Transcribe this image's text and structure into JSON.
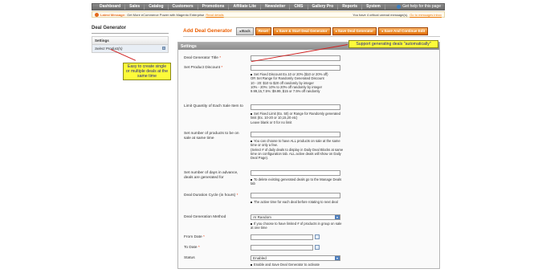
{
  "topnav": {
    "items": [
      "Dashboard",
      "Sales",
      "Catalog",
      "Customers",
      "Promotions",
      "Affiliate Lite",
      "Newsletter",
      "CMS",
      "Gallery Pro",
      "Reports",
      "System"
    ],
    "help": "Get help for this page"
  },
  "message": {
    "title": "Latest Message:",
    "text": "Get More eCommerce Power with Magento Enterprise",
    "link": "Read details",
    "right_text": "You have 4 critical unread message(s).",
    "right_link": "Go to messages inbox"
  },
  "sidebar": {
    "title": "Deal Generator",
    "section": "Settings",
    "item": "Select Product(s)"
  },
  "callouts": {
    "left": "Easy to create single or multiple deals at the same time",
    "right": "Support generating deals \"automatically\""
  },
  "header": {
    "title": "Add Deal Generator",
    "buttons": {
      "back": "Back",
      "reset": "Reset",
      "save_start": "Save & Start Deal Generator",
      "save": "Save Deal Generator",
      "save_continue": "Save And Continue Edit"
    }
  },
  "form": {
    "panel_title": "Settings",
    "fields": {
      "title": {
        "label": "Deal Generator Title",
        "value": ""
      },
      "discount": {
        "label": "Set Product Discount",
        "value": "",
        "note": [
          "Set Fixed Discount Ex.10 or 20% ($10 or 20% off)",
          "OR Set Range for Randomly Generated Discount",
          "10 - 20: $10 to $20 off randomly by integer",
          "10% - 20%: 10% to 20% off randomly by integer",
          "9.99,15,7.5%: $9.99, $15 or 7.5% off randomly"
        ]
      },
      "limit": {
        "label": "Limit Quantity of Each Sale Item to",
        "value": "",
        "note": [
          "Set Fixed Limit (Ex. 50) or Range for Randomly generated limit (Ex. 10-20 or 10,15,20 etc)",
          "Leave blank or 0 for no limit"
        ]
      },
      "products_count": {
        "label": "Set number of products to be on sale at same time",
        "value": "",
        "note": [
          "You can choose to have ALL products on sale at the same time or only a few.",
          "(Select # of daily deals to display in Daily Deal Blocks at same time on configuration tab. ALL active deals will show on Daily Deal Page)."
        ]
      },
      "days_advance": {
        "label": "Set number of days in advance, deals are generated for",
        "value": "",
        "note": [
          "To delete existing generated deals go to the Manage Deals tab"
        ]
      },
      "duration": {
        "label": "Deal Duration Cycle (in hours)",
        "value": "",
        "note": [
          "The active time for each deal before rotating to next deal"
        ]
      },
      "method": {
        "label": "Deal Generation Method",
        "value": "At Random",
        "note": [
          "If you choose to have limited # of products in group on sale at one time"
        ]
      },
      "from_date": {
        "label": "From Date",
        "value": ""
      },
      "to_date": {
        "label": "To Date",
        "value": ""
      },
      "status": {
        "label": "Status",
        "value": "Enabled",
        "note": [
          "Enable and Save Deal Generator to activate"
        ]
      }
    }
  },
  "colors": {
    "accent": "#eb5e00",
    "button": "#e06c00",
    "callout": "#fdfb3a",
    "arrow": "#d02020"
  }
}
